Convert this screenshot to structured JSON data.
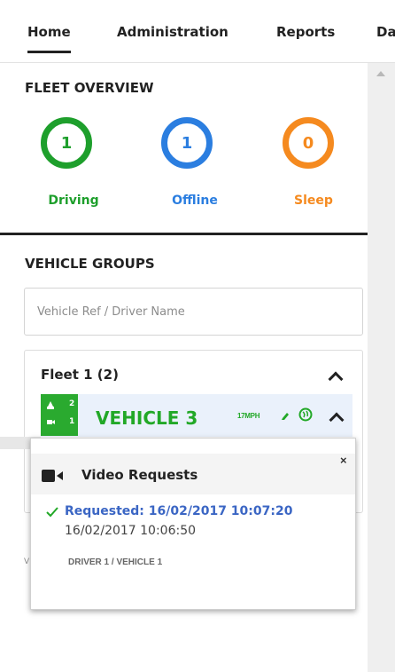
{
  "nav": {
    "tabs": [
      "Home",
      "Administration",
      "Reports",
      "Da"
    ],
    "active": "Home"
  },
  "overview": {
    "title": "FLEET OVERVIEW",
    "stats": [
      {
        "value": "1",
        "label": "Driving",
        "color": "#1e9f2c"
      },
      {
        "value": "1",
        "label": "Offline",
        "color": "#2b7ee0"
      },
      {
        "value": "0",
        "label": "Sleep",
        "color": "#f58a1f"
      }
    ]
  },
  "groups": {
    "title": "VEHICLE GROUPS",
    "search_placeholder": "Vehicle Ref / Driver Name",
    "fleet": {
      "title": "Fleet 1 (2)",
      "vehicle": {
        "badge_top": "2",
        "badge_bottom": "1",
        "name": "VEHICLE 3",
        "speed": "17MPH"
      }
    }
  },
  "popup": {
    "title": "Video Requests",
    "close": "×",
    "requested": "Requested: 16/02/2017 10:07:20",
    "time": "16/02/2017 10:06:50",
    "driver": "DRIVER 1 / VEHICLE 1",
    "stray": "V"
  },
  "colors": {
    "accent_green": "#2aaa2f",
    "link_blue": "#3b66c4"
  },
  "icons": [
    "video-camera-icon",
    "pencil-icon",
    "globe-icon",
    "check-icon",
    "car-icon",
    "chevron-up-icon",
    "close-icon"
  ]
}
